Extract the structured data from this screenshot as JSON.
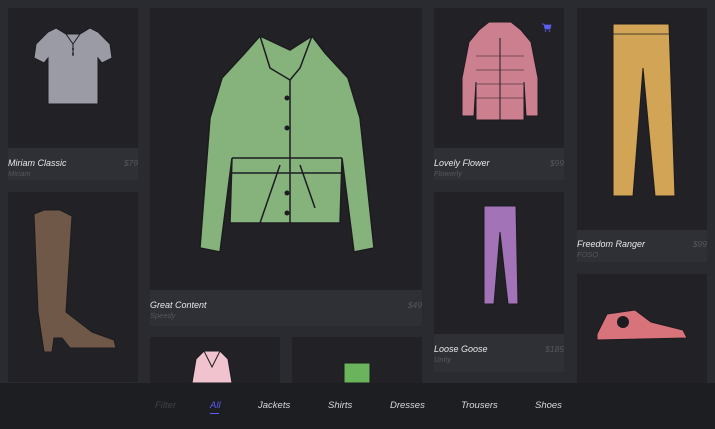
{
  "products": [
    {
      "id": "polo",
      "name": "Miriam Classic",
      "brand": "Miriam",
      "price": "$79",
      "icon": "polo-shirt-icon",
      "color": "#9a9ba5"
    },
    {
      "id": "jacket",
      "name": "Great Content",
      "brand": "Speedy",
      "price": "$49",
      "icon": "jacket-icon",
      "color": "#86b37c"
    },
    {
      "id": "puffer",
      "name": "Lovely Flower",
      "brand": "Flowerly",
      "price": "$99",
      "icon": "puffer-jacket-icon",
      "color": "#cc7f8f"
    },
    {
      "id": "pants",
      "name": "Freedom Ranger",
      "brand": "FOSO",
      "price": "$99",
      "icon": "trousers-icon",
      "color": "#d2a455"
    },
    {
      "id": "boot",
      "name": "",
      "brand": "",
      "price": "",
      "icon": "boot-icon",
      "color": "#6f5848"
    },
    {
      "id": "trousers",
      "name": "Loose Goose",
      "brand": "Unity",
      "price": "$185",
      "icon": "purple-trousers-icon",
      "color": "#a373b7"
    },
    {
      "id": "sneaker",
      "name": "",
      "brand": "",
      "price": "",
      "icon": "sneaker-icon",
      "color": "#d9737b"
    },
    {
      "id": "top",
      "name": "",
      "brand": "",
      "price": "",
      "icon": "top-icon",
      "color": "#f0c3cf"
    },
    {
      "id": "green-item",
      "name": "",
      "brand": "",
      "price": "",
      "icon": "green-item-icon",
      "color": "#6bb35c"
    }
  ],
  "filters": {
    "label": "Filter",
    "items": [
      "All",
      "Jackets",
      "Shirts",
      "Dresses",
      "Trousers",
      "Shoes"
    ],
    "active": "All"
  },
  "colors": {
    "accent": "#5a5ff0",
    "background": "#2a2b30",
    "card": "#212126"
  }
}
